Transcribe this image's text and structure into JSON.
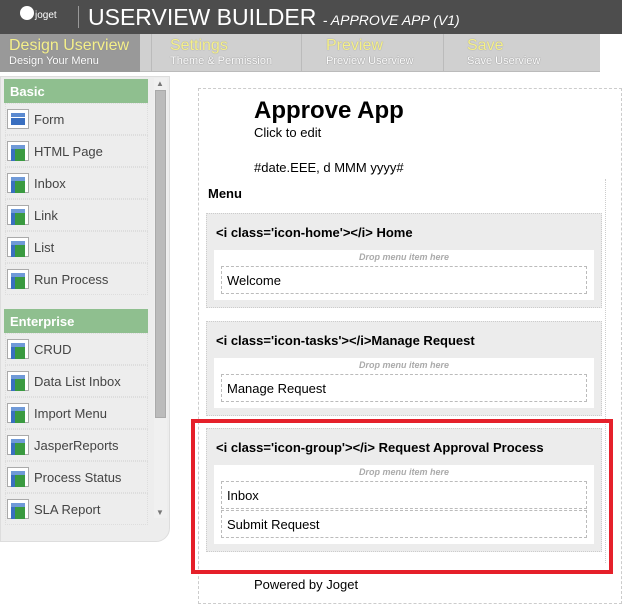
{
  "header": {
    "logo": "joget",
    "title": "USERVIEW BUILDER",
    "subtitle": "- APPROVE APP (V1)"
  },
  "steps": [
    {
      "label": "Design Userview",
      "sub": "Design Your Menu",
      "active": true
    },
    {
      "label": "Settings",
      "sub": "Theme & Permission"
    },
    {
      "label": "Preview",
      "sub": "Preview Userview"
    },
    {
      "label": "Save",
      "sub": "Save Userview"
    }
  ],
  "sidebar": {
    "basic": {
      "title": "Basic",
      "items": [
        "Form",
        "HTML Page",
        "Inbox",
        "Link",
        "List",
        "Run Process"
      ]
    },
    "enterprise": {
      "title": "Enterprise",
      "items": [
        "CRUD",
        "Data List Inbox",
        "Import Menu",
        "JasperReports",
        "Process Status",
        "SLA Report"
      ]
    }
  },
  "canvas": {
    "app_name": "Approve App",
    "click_to_edit": "Click to edit",
    "date": "#date.EEE, d MMM yyyy#",
    "menu_label": "Menu",
    "drop_hint": "Drop menu item here",
    "categories": [
      {
        "title": "<i class='icon-home'></i> Home",
        "items": [
          "Welcome"
        ]
      },
      {
        "title": "<i class='icon-tasks'></i>Manage Request",
        "items": [
          "Manage Request"
        ]
      },
      {
        "title": "<i class='icon-group'></i> Request Approval Process",
        "items": [
          "Inbox",
          "Submit Request"
        ]
      }
    ],
    "footer": "Powered by Joget"
  },
  "colors": {
    "highlight": "#e5202a",
    "category_header": "#8fbf8f",
    "header_bg": "#4d4d4d"
  }
}
